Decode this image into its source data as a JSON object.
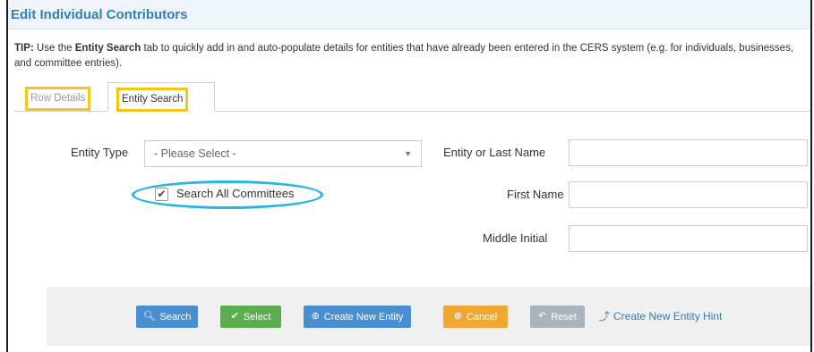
{
  "header": {
    "title": "Edit Individual Contributors"
  },
  "tip": {
    "prefix": "TIP:",
    "text_before": " Use the ",
    "bold": "Entity Search",
    "text_after": " tab to quickly add in and auto-populate details for entities that have already been entered in the CERS system (e.g. for individuals, businesses, and committee entries)."
  },
  "tabs": [
    {
      "label": "Row Details",
      "active": false
    },
    {
      "label": "Entity Search",
      "active": true
    }
  ],
  "form": {
    "entity_type_label": "Entity Type",
    "entity_type_value": "- Please Select -",
    "search_all_label": "Search All Committees",
    "search_all_checked": true,
    "entity_last_name_label": "Entity or Last Name",
    "entity_last_name_value": "",
    "first_name_label": "First Name",
    "first_name_value": "",
    "middle_initial_label": "Middle Initial",
    "middle_initial_value": ""
  },
  "buttons": {
    "search": "Search",
    "select": "Select",
    "create": "Create New Entity",
    "cancel": "Cancel",
    "reset": "Reset",
    "hint": "Create New Entity Hint"
  },
  "colors": {
    "title": "#2f7fb8",
    "highlight_box": "#f5c518",
    "highlight_oval": "#26b4e0",
    "btn_primary": "#4a8ecf",
    "btn_success": "#5bae4f",
    "btn_warning": "#f0a732",
    "btn_disabled": "#a8b3bc"
  },
  "icons": {
    "search": "search-icon",
    "select": "check-icon",
    "create": "plus-circle-icon",
    "cancel": "x-circle-icon",
    "reset": "undo-icon",
    "hint": "share-icon",
    "dropdown": "caret-down-icon"
  }
}
